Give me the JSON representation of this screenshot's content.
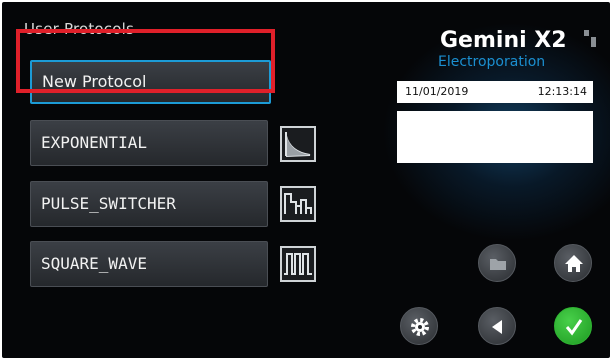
{
  "header": {
    "section_title": "User Protocols"
  },
  "brand": {
    "title": "Gemini X2",
    "subtitle": "Electroporation"
  },
  "datetime": {
    "date": "11/01/2019",
    "time": "12:13:14"
  },
  "protocols": {
    "new_label": "New Protocol",
    "items": [
      {
        "label": "EXPONENTIAL",
        "icon": "exponential-decay-icon"
      },
      {
        "label": "PULSE_SWITCHER",
        "icon": "pulse-switcher-icon"
      },
      {
        "label": "SQUARE_WAVE",
        "icon": "square-wave-icon"
      }
    ]
  },
  "nav": {
    "buttons": [
      "folder-icon",
      "home-icon",
      "gear-icon",
      "back-icon",
      "checkmark-icon"
    ]
  },
  "colors": {
    "accent": "#1b8fd0",
    "highlight": "#e0202a",
    "confirm": "#2fb532",
    "background": "#050608"
  }
}
